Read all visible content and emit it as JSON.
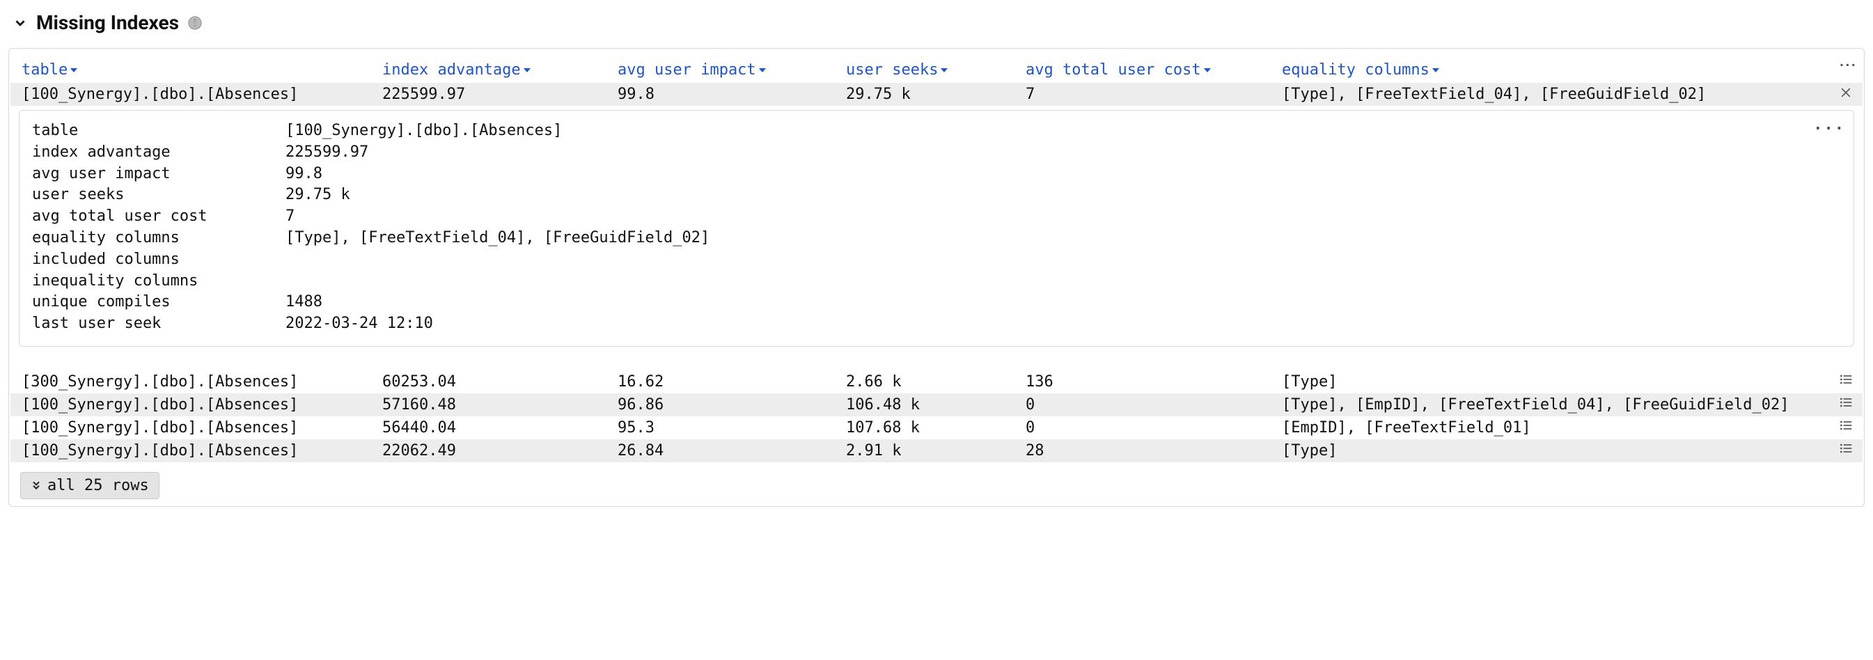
{
  "section_title": "Missing Indexes",
  "kebab": "...",
  "columns": [
    "table",
    "index advantage",
    "avg user impact",
    "user seeks",
    "avg total user cost",
    "equality columns"
  ],
  "selected_row": {
    "table": "[100_Synergy].[dbo].[Absences]",
    "index_advantage": "225599.97",
    "avg_user_impact": "99.8",
    "user_seeks": "29.75 k",
    "avg_total_user_cost": "7",
    "equality_columns": "[Type], [FreeTextField_04], [FreeGuidField_02]"
  },
  "detail_rows": [
    {
      "k": "table",
      "v": "[100_Synergy].[dbo].[Absences]"
    },
    {
      "k": "index advantage",
      "v": "225599.97"
    },
    {
      "k": "avg user impact",
      "v": "99.8"
    },
    {
      "k": "user seeks",
      "v": "29.75 k"
    },
    {
      "k": "avg total user cost",
      "v": "7"
    },
    {
      "k": "equality columns",
      "v": "[Type], [FreeTextField_04], [FreeGuidField_02]"
    },
    {
      "k": "included columns",
      "v": ""
    },
    {
      "k": "inequality columns",
      "v": ""
    },
    {
      "k": "unique compiles",
      "v": "1488"
    },
    {
      "k": "last user seek",
      "v": "2022-03-24 12:10"
    }
  ],
  "rows": [
    {
      "table": "[300_Synergy].[dbo].[Absences]",
      "idx": "60253.04",
      "imp": "16.62",
      "seeks": "2.66 k",
      "cost": "136",
      "eq": "[Type]"
    },
    {
      "table": "[100_Synergy].[dbo].[Absences]",
      "idx": "57160.48",
      "imp": "96.86",
      "seeks": "106.48 k",
      "cost": "0",
      "eq": "[Type], [EmpID], [FreeTextField_04], [FreeGuidField_02]"
    },
    {
      "table": "[100_Synergy].[dbo].[Absences]",
      "idx": "56440.04",
      "imp": "95.3",
      "seeks": "107.68 k",
      "cost": "0",
      "eq": "[EmpID], [FreeTextField_01]"
    },
    {
      "table": "[100_Synergy].[dbo].[Absences]",
      "idx": "22062.49",
      "imp": "26.84",
      "seeks": "2.91 k",
      "cost": "28",
      "eq": "[Type]"
    }
  ],
  "footer_label": "all 25 rows"
}
